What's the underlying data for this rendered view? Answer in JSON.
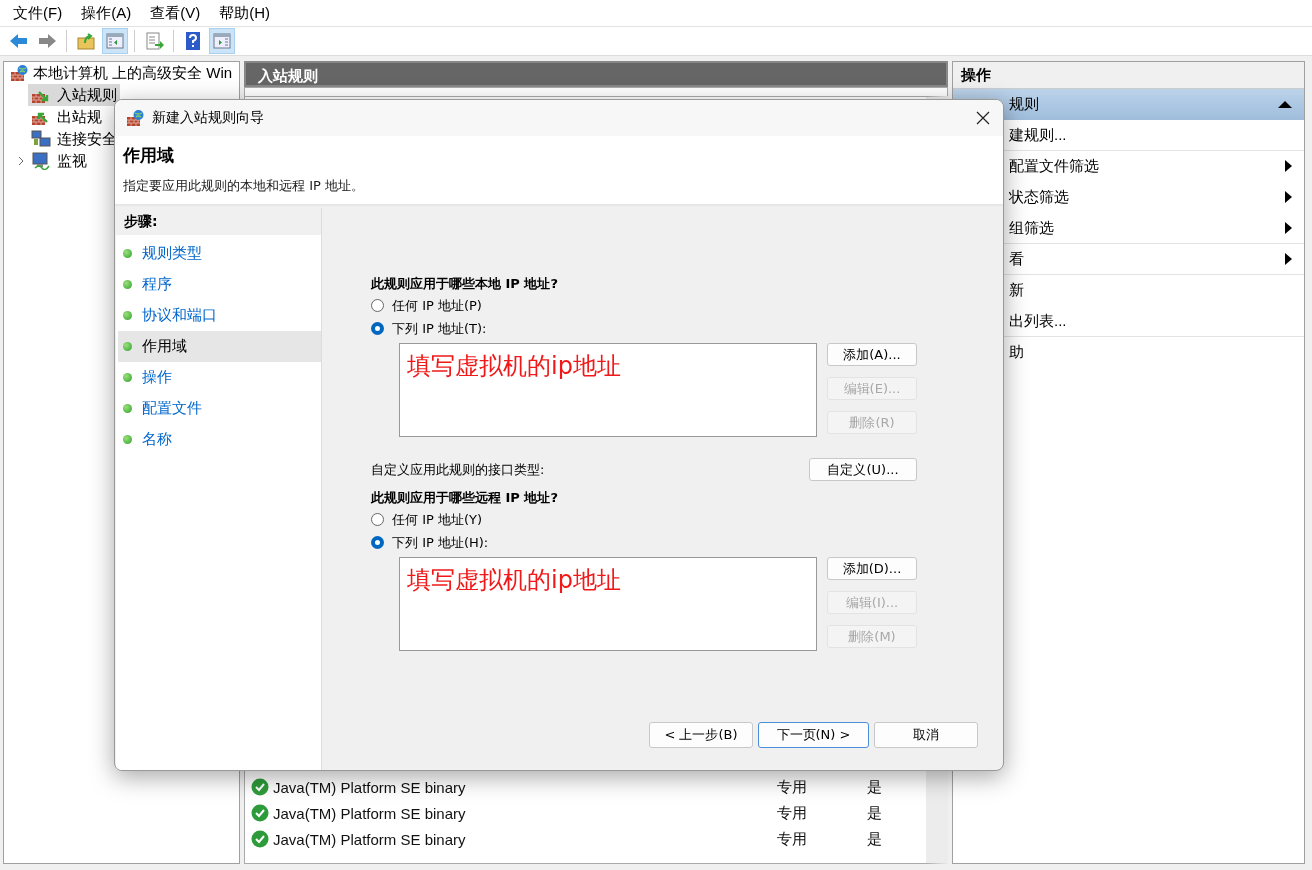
{
  "menu": [
    "文件(F)",
    "操作(A)",
    "查看(V)",
    "帮助(H)"
  ],
  "toolbar": [
    {
      "kind": "back",
      "pressed": false
    },
    {
      "kind": "forward",
      "pressed": false
    },
    {
      "kind": "separator"
    },
    {
      "kind": "up-folder",
      "pressed": false
    },
    {
      "kind": "tree-pane",
      "pressed": true
    },
    {
      "kind": "separator"
    },
    {
      "kind": "export",
      "pressed": false
    },
    {
      "kind": "separator"
    },
    {
      "kind": "help",
      "pressed": false
    },
    {
      "kind": "action-pane",
      "pressed": true
    }
  ],
  "tree": {
    "label": "本地计算机 上的高级安全 Win",
    "children": [
      {
        "label": "入站规则",
        "kind": "inbound",
        "selected": true,
        "expandable": false
      },
      {
        "label": "出站规",
        "kind": "outbound",
        "selected": false,
        "expandable": false
      },
      {
        "label": "连接安全",
        "kind": "security",
        "selected": false,
        "expandable": false
      },
      {
        "label": "监视",
        "kind": "monitor",
        "selected": false,
        "expandable": true
      }
    ]
  },
  "rules_pane": {
    "title": "入站规则",
    "rows": [
      {
        "name": "Java(TM) Platform SE binary",
        "profile": "专用",
        "enabled": "是"
      },
      {
        "name": "Java(TM) Platform SE binary",
        "profile": "专用",
        "enabled": "是"
      },
      {
        "name": "Java(TM) Platform SE binary",
        "profile": "专用",
        "enabled": "是"
      }
    ]
  },
  "actions_pane": {
    "title": "操作",
    "section": {
      "label": "规则",
      "expanded": true
    },
    "items": [
      {
        "label": "建规则...",
        "submenu": false,
        "separator_after": true
      },
      {
        "label": "配置文件筛选",
        "submenu": true,
        "separator_after": false
      },
      {
        "label": "状态筛选",
        "submenu": true,
        "separator_after": false
      },
      {
        "label": "组筛选",
        "submenu": true,
        "separator_after": true
      },
      {
        "label": "看",
        "submenu": true,
        "separator_after": true
      },
      {
        "label": "新",
        "submenu": false,
        "separator_after": false
      },
      {
        "label": "出列表...",
        "submenu": false,
        "separator_after": true
      },
      {
        "label": "助",
        "submenu": false,
        "separator_after": false
      }
    ]
  },
  "dialog": {
    "title": "新建入站规则向导",
    "heading": "作用域",
    "description": "指定要应用此规则的本地和远程 IP 地址。",
    "steps_title": "步骤:",
    "steps": [
      {
        "label": "规则类型",
        "selected": false
      },
      {
        "label": "程序",
        "selected": false
      },
      {
        "label": "协议和端口",
        "selected": false
      },
      {
        "label": "作用域",
        "selected": true
      },
      {
        "label": "操作",
        "selected": false
      },
      {
        "label": "配置文件",
        "selected": false
      },
      {
        "label": "名称",
        "selected": false
      }
    ],
    "local": {
      "question": "此规则应用于哪些本地 IP 地址?",
      "options": [
        {
          "label": "任何 IP 地址(P)",
          "selected": false
        },
        {
          "label": "下列 IP 地址(T):",
          "selected": true
        }
      ],
      "list_text": "填写虚拟机的ip地址",
      "buttons": [
        {
          "label": "添加(A)...",
          "disabled": false
        },
        {
          "label": "编辑(E)...",
          "disabled": true
        },
        {
          "label": "删除(R)",
          "disabled": true
        }
      ]
    },
    "interface": {
      "label": "自定义应用此规则的接口类型:",
      "button": "自定义(U)..."
    },
    "remote": {
      "question": "此规则应用于哪些远程 IP 地址?",
      "options": [
        {
          "label": "任何 IP 地址(Y)",
          "selected": false
        },
        {
          "label": "下列 IP 地址(H):",
          "selected": true
        }
      ],
      "list_text": "填写虚拟机的ip地址",
      "buttons": [
        {
          "label": "添加(D)...",
          "disabled": false
        },
        {
          "label": "编辑(I)...",
          "disabled": true
        },
        {
          "label": "删除(M)",
          "disabled": true
        }
      ]
    },
    "footer": [
      {
        "label": "< 上一步(B)",
        "default": false
      },
      {
        "label": "下一页(N) >",
        "default": true
      },
      {
        "label": "取消",
        "default": false
      }
    ]
  }
}
